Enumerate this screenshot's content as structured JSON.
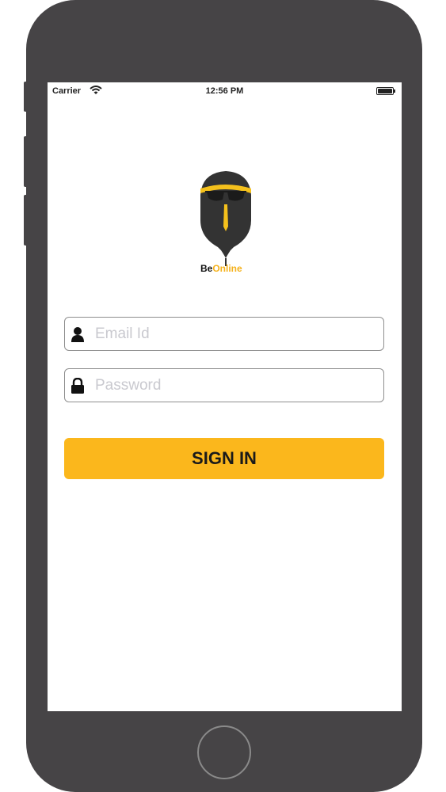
{
  "status_bar": {
    "carrier": "Carrier",
    "time": "12:56 PM"
  },
  "logo": {
    "text_prefix": "Be",
    "text_highlight": "Online"
  },
  "login_form": {
    "email_placeholder": "Email Id",
    "password_placeholder": "Password",
    "signin_label": "SIGN IN"
  },
  "colors": {
    "accent": "#fbb71c",
    "device_frame": "#464446"
  },
  "icons": {
    "email": "user-icon",
    "password": "lock-icon",
    "wifi": "wifi-icon",
    "battery": "battery-icon"
  }
}
